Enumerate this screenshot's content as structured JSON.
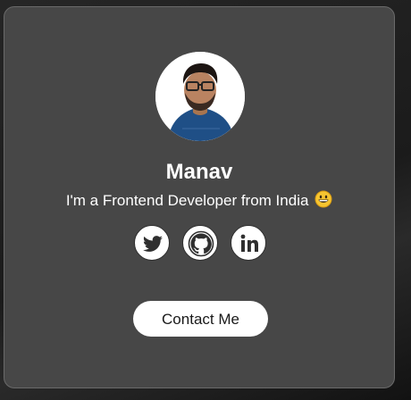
{
  "profile": {
    "name": "Manav",
    "tagline": "I'm a Frontend Developer from India",
    "tagline_emoji": "grinning-face-emoji",
    "avatar": "profile-photo"
  },
  "social": [
    {
      "network": "Twitter",
      "icon": "twitter-icon"
    },
    {
      "network": "GitHub",
      "icon": "github-icon"
    },
    {
      "network": "LinkedIn",
      "icon": "linkedin-icon"
    }
  ],
  "actions": {
    "contact_label": "Contact Me"
  },
  "colors": {
    "card_background": "#474747",
    "card_border": "#6a6a6a",
    "page_background": "#1e1e1e",
    "text": "#ffffff",
    "button_background": "#ffffff",
    "button_text": "#1a1a1a",
    "icon_color": "#2f2f2f"
  }
}
